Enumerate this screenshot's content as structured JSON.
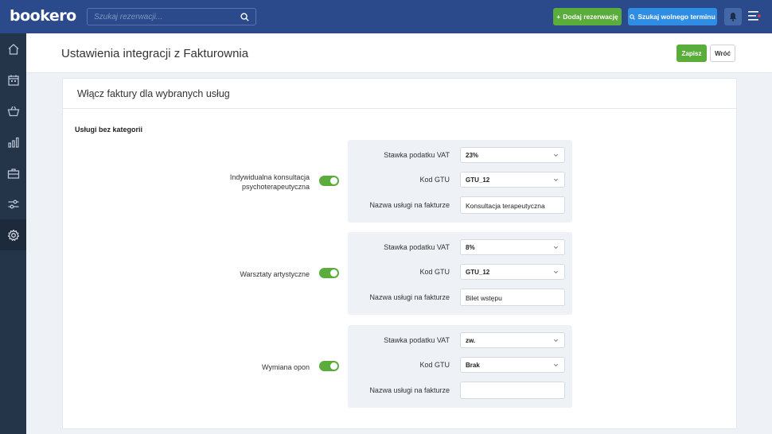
{
  "topbar": {
    "logo": "bookero",
    "search_placeholder": "Szukaj rezerwacji...",
    "add_reservation_label": "Dodaj rezerwację",
    "find_slot_label": "Szukaj wolnego terminu"
  },
  "sidebar": {
    "items": [
      {
        "icon": "home-icon"
      },
      {
        "icon": "calendar-icon"
      },
      {
        "icon": "basket-icon"
      },
      {
        "icon": "bar-chart-icon"
      },
      {
        "icon": "briefcase-icon"
      },
      {
        "icon": "sliders-icon"
      },
      {
        "icon": "gear-icon",
        "active": true
      }
    ]
  },
  "header": {
    "title": "Ustawienia integracji z Fakturownia",
    "save_label": "Zapisz",
    "back_label": "Wróć"
  },
  "card": {
    "title": "Włącz faktury dla wybranych usług",
    "category": "Usługi bez kategorii",
    "field_labels": {
      "vat": "Stawka podatku VAT",
      "gtu": "Kod GTU",
      "invoice_name": "Nazwa usługi na fakturze"
    },
    "services": [
      {
        "name": "Indywidualna konsultacja psychoterapeutyczna",
        "enabled": true,
        "vat": "23%",
        "gtu": "GTU_12",
        "invoice_name": "Konsultacja terapeutyczna"
      },
      {
        "name": "Warsztaty artystyczne",
        "enabled": true,
        "vat": "8%",
        "gtu": "GTU_12",
        "invoice_name": "Bilet wstępu"
      },
      {
        "name": "Wymiana opon",
        "enabled": true,
        "vat": "zw.",
        "gtu": "Brak",
        "invoice_name": ""
      }
    ]
  },
  "colors": {
    "topbar": "#2b4a8c",
    "sidebar": "#243449",
    "green": "#5aad3a",
    "blue": "#2f8de4"
  }
}
